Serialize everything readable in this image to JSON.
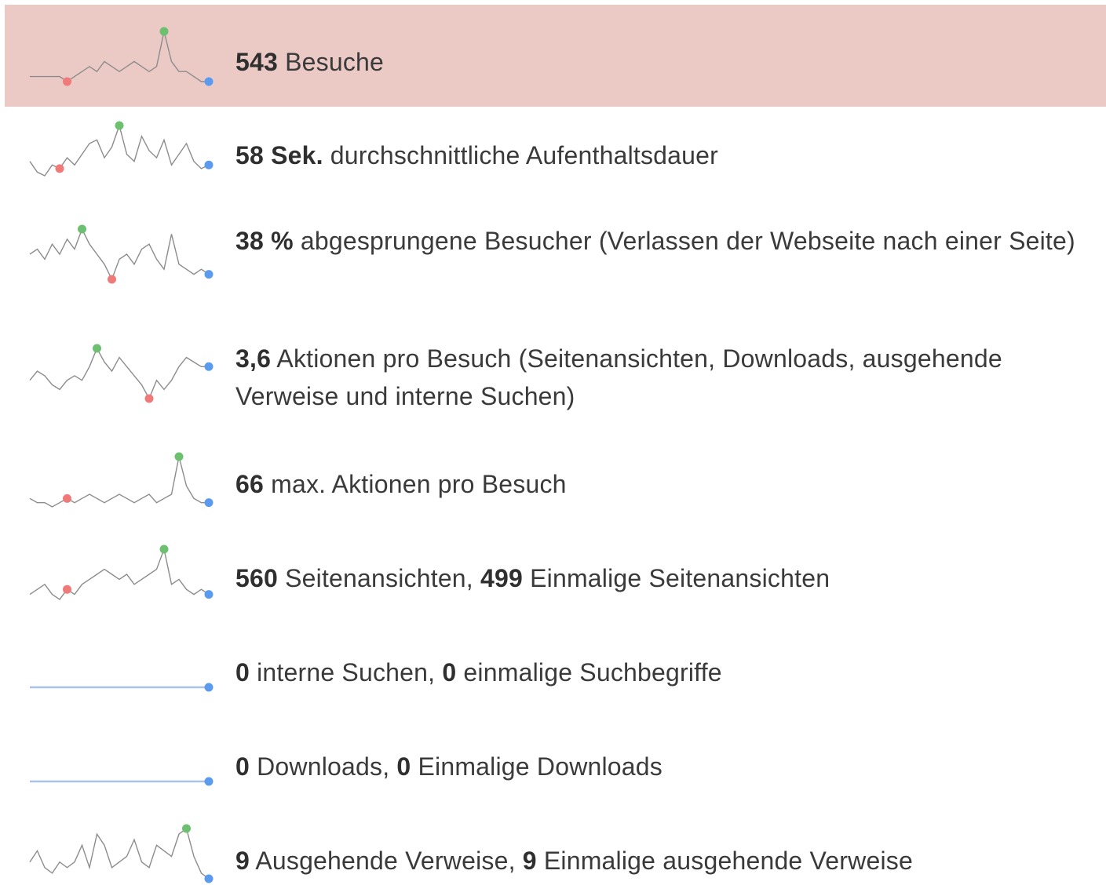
{
  "colors": {
    "highlight_bg": "#ebcac6",
    "sparkline": "#8c8c8c",
    "flat_line": "#a9c4e6",
    "min_dot": "#f07a7a",
    "max_dot": "#6cc070",
    "last_dot": "#5b9bef"
  },
  "metrics": [
    {
      "key": "visits",
      "highlighted": true,
      "parts": [
        {
          "v": "543",
          "b": true
        },
        {
          "v": " Besuche",
          "b": false
        }
      ],
      "spark": {
        "values": [
          2,
          2,
          2,
          2,
          2,
          1,
          2,
          3,
          4,
          3,
          5,
          4,
          3,
          4,
          5,
          4,
          3,
          4,
          11,
          5,
          3,
          3,
          2,
          1,
          1
        ],
        "min": 5,
        "max": 18,
        "flat": false
      }
    },
    {
      "key": "avg_time",
      "highlighted": false,
      "parts": [
        {
          "v": "58 Sek.",
          "b": true
        },
        {
          "v": " durchschnittliche Aufenthaltsdauer",
          "b": false
        }
      ],
      "spark": {
        "values": [
          5,
          2,
          1,
          4,
          3,
          6,
          4,
          7,
          10,
          11,
          6,
          9,
          15,
          7,
          5,
          12,
          8,
          6,
          11,
          4,
          7,
          10,
          5,
          3,
          4
        ],
        "min": 4,
        "max": 12,
        "flat": false
      }
    },
    {
      "key": "bounce",
      "highlighted": false,
      "parts": [
        {
          "v": "38 %",
          "b": true
        },
        {
          "v": " abgesprungene Besucher (Verlassen der Webseite nach einer Seite)",
          "b": false
        }
      ],
      "spark": {
        "values": [
          7,
          8,
          6,
          9,
          7,
          10,
          8,
          12,
          9,
          7,
          5,
          2,
          6,
          7,
          5,
          8,
          9,
          6,
          4,
          11,
          5,
          4,
          3,
          4,
          3
        ],
        "min": 11,
        "max": 7,
        "flat": false
      }
    },
    {
      "key": "actions",
      "highlighted": false,
      "parts": [
        {
          "v": "3,6",
          "b": true
        },
        {
          "v": " Aktionen pro Besuch (Seitenansichten, Downloads, ausgehende Verweise und interne Suchen)",
          "b": false
        }
      ],
      "spark": {
        "values": [
          5,
          7,
          6,
          4,
          3,
          5,
          6,
          5,
          8,
          12,
          9,
          7,
          10,
          8,
          6,
          4,
          1,
          5,
          3,
          5,
          8,
          10,
          9,
          8,
          8
        ],
        "min": 16,
        "max": 9,
        "flat": false
      }
    },
    {
      "key": "max_actions",
      "highlighted": false,
      "parts": [
        {
          "v": "66",
          "b": true
        },
        {
          "v": " max. Aktionen pro Besuch",
          "b": false
        }
      ],
      "spark": {
        "values": [
          3,
          2,
          2,
          1,
          2,
          3,
          2,
          3,
          4,
          3,
          2,
          3,
          4,
          3,
          2,
          3,
          4,
          2,
          3,
          4,
          13,
          6,
          3,
          2,
          2
        ],
        "min": 5,
        "max": 20,
        "flat": false
      }
    },
    {
      "key": "pageviews",
      "highlighted": false,
      "parts": [
        {
          "v": "560",
          "b": true
        },
        {
          "v": " Seitenansichten, ",
          "b": false
        },
        {
          "v": "499",
          "b": true
        },
        {
          "v": " Einmalige Seitenansichten",
          "b": false
        }
      ],
      "spark": {
        "values": [
          2,
          3,
          4,
          2,
          1,
          3,
          2,
          4,
          5,
          6,
          7,
          6,
          5,
          6,
          4,
          5,
          6,
          7,
          11,
          4,
          5,
          3,
          2,
          3,
          2
        ],
        "min": 5,
        "max": 18,
        "flat": false
      }
    },
    {
      "key": "searches",
      "highlighted": false,
      "parts": [
        {
          "v": "0",
          "b": true
        },
        {
          "v": " interne Suchen, ",
          "b": false
        },
        {
          "v": "0",
          "b": true
        },
        {
          "v": " einmalige Suchbegriffe",
          "b": false
        }
      ],
      "spark": {
        "values": [
          0,
          0,
          0,
          0,
          0,
          0,
          0,
          0,
          0,
          0,
          0,
          0,
          0,
          0,
          0,
          0,
          0,
          0,
          0,
          0,
          0,
          0,
          0,
          0,
          0
        ],
        "min": -1,
        "max": -1,
        "flat": true
      }
    },
    {
      "key": "downloads",
      "highlighted": false,
      "parts": [
        {
          "v": "0",
          "b": true
        },
        {
          "v": " Downloads, ",
          "b": false
        },
        {
          "v": "0",
          "b": true
        },
        {
          "v": " Einmalige Downloads",
          "b": false
        }
      ],
      "spark": {
        "values": [
          0,
          0,
          0,
          0,
          0,
          0,
          0,
          0,
          0,
          0,
          0,
          0,
          0,
          0,
          0,
          0,
          0,
          0,
          0,
          0,
          0,
          0,
          0,
          0,
          0
        ],
        "min": -1,
        "max": -1,
        "flat": true
      }
    },
    {
      "key": "outlinks",
      "highlighted": false,
      "parts": [
        {
          "v": "9",
          "b": true
        },
        {
          "v": " Ausgehende Verweise, ",
          "b": false
        },
        {
          "v": "9",
          "b": true
        },
        {
          "v": " Einmalige ausgehende Verweise",
          "b": false
        }
      ],
      "spark": {
        "values": [
          3,
          5,
          2,
          1,
          3,
          2,
          3,
          6,
          2,
          8,
          6,
          2,
          3,
          4,
          7,
          3,
          2,
          6,
          5,
          4,
          8,
          9,
          4,
          1,
          0
        ],
        "min": -1,
        "max": 21,
        "flat": false
      }
    }
  ]
}
